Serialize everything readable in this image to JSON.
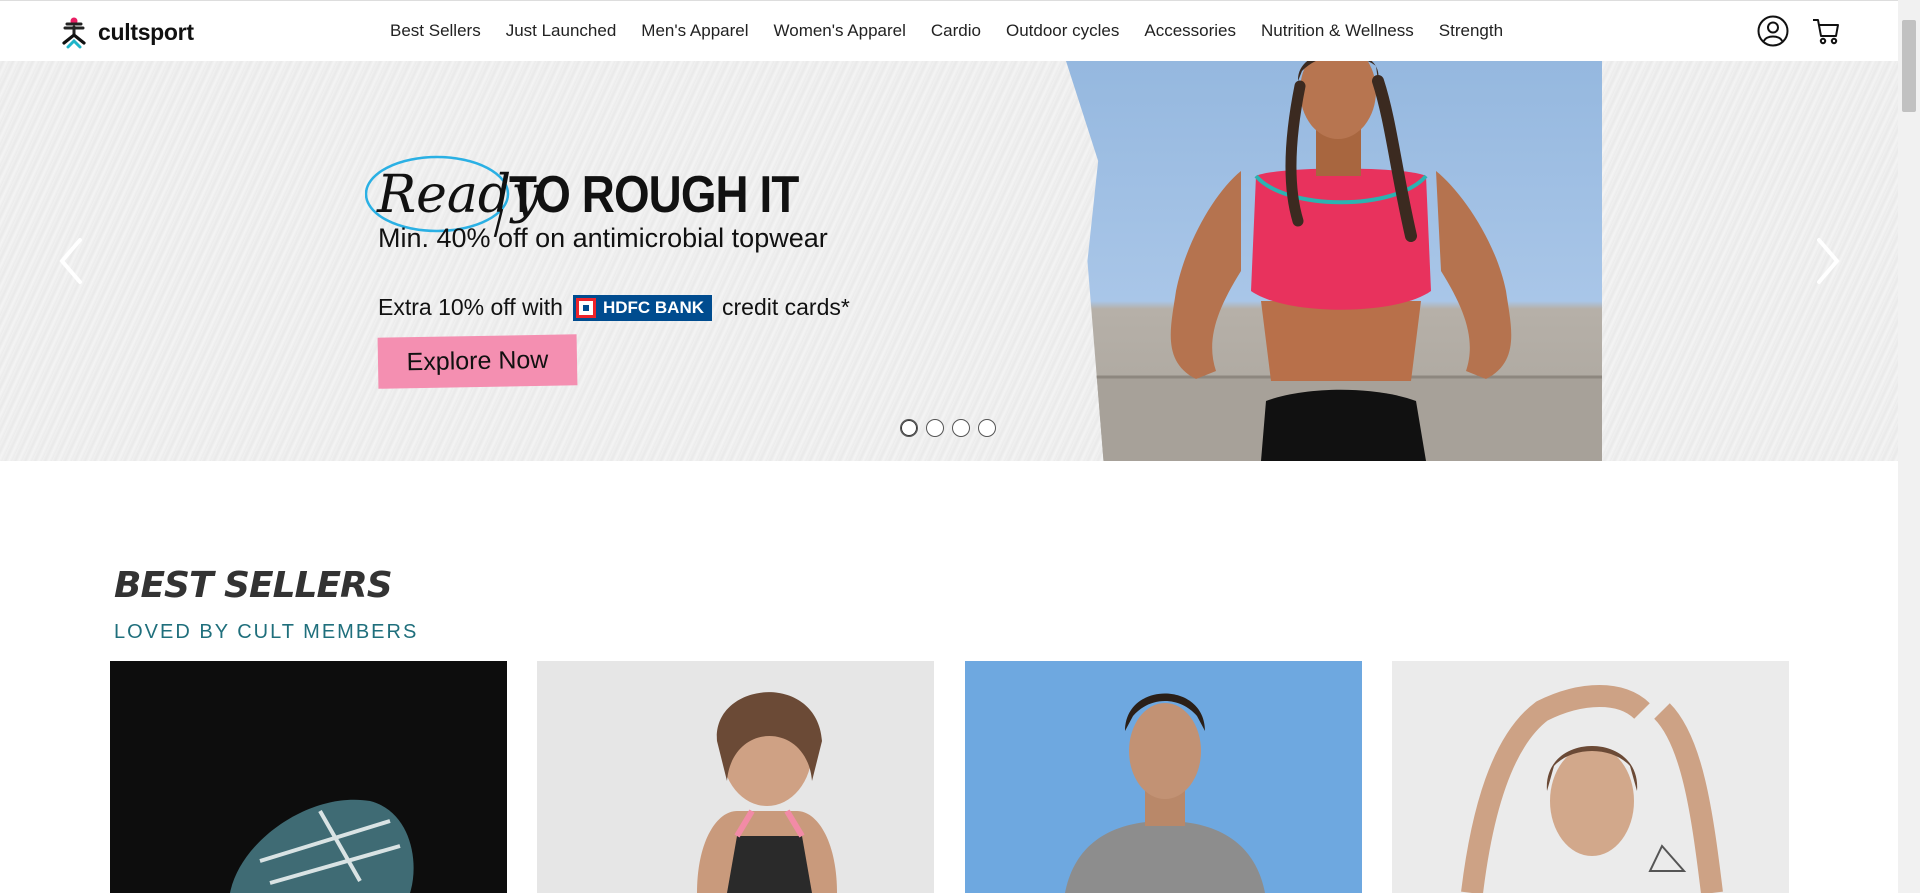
{
  "brand": {
    "name": "cultsport"
  },
  "nav": {
    "items": [
      {
        "label": "Best Sellers"
      },
      {
        "label": "Just Launched"
      },
      {
        "label": "Men's Apparel"
      },
      {
        "label": "Women's Apparel"
      },
      {
        "label": "Cardio"
      },
      {
        "label": "Outdoor cycles"
      },
      {
        "label": "Accessories"
      },
      {
        "label": "Nutrition & Wellness"
      },
      {
        "label": "Strength"
      }
    ]
  },
  "header_icons": {
    "account": "user-circle-icon",
    "cart": "cart-icon"
  },
  "hero": {
    "title_script": "Ready",
    "title_bold": "TO ROUGH IT",
    "subtitle": "Min. 40% off on antimicrobial topwear",
    "offer_prefix": "Extra 10% off with",
    "bank_name": "HDFC BANK",
    "offer_suffix": "credit cards*",
    "cta_label": "Explore Now",
    "slides": 4,
    "active_slide": 1,
    "cta_color": "#f48fb1",
    "bank_color": "#004c8f"
  },
  "best_sellers": {
    "title": "BEST SELLERS",
    "subtitle": "LOVED BY CULT MEMBERS",
    "accent_color": "#1f6f7c",
    "cards": [
      "shoe-product",
      "sports-bra-product",
      "mens-tshirt-product",
      "womens-top-product"
    ]
  }
}
